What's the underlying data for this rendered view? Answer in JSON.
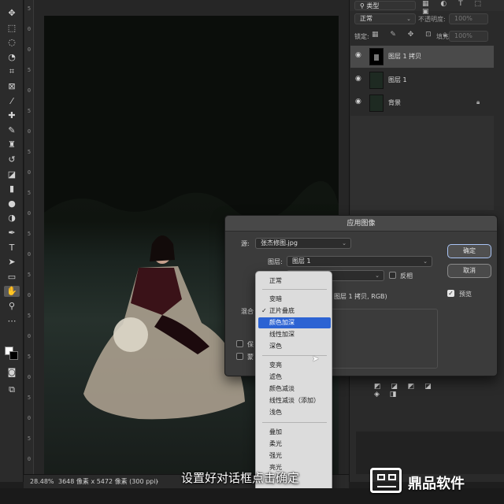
{
  "toolbar": {
    "tools": [
      {
        "name": "move-tool",
        "glyph": "✥"
      },
      {
        "name": "marquee-tool",
        "glyph": "⬚"
      },
      {
        "name": "lasso-tool",
        "glyph": "◌"
      },
      {
        "name": "quick-select-tool",
        "glyph": "◔"
      },
      {
        "name": "crop-tool",
        "glyph": "⌗"
      },
      {
        "name": "frame-tool",
        "glyph": "⊠"
      },
      {
        "name": "eyedropper-tool",
        "glyph": "⁄"
      },
      {
        "name": "healing-brush-tool",
        "glyph": "✚"
      },
      {
        "name": "brush-tool",
        "glyph": "✎"
      },
      {
        "name": "clone-stamp-tool",
        "glyph": "♜"
      },
      {
        "name": "history-brush-tool",
        "glyph": "↺"
      },
      {
        "name": "eraser-tool",
        "glyph": "◪"
      },
      {
        "name": "gradient-tool",
        "glyph": "▮"
      },
      {
        "name": "blur-tool",
        "glyph": "●"
      },
      {
        "name": "dodge-tool",
        "glyph": "◑"
      },
      {
        "name": "pen-tool",
        "glyph": "✒"
      },
      {
        "name": "type-tool",
        "glyph": "T"
      },
      {
        "name": "path-selection-tool",
        "glyph": "➤"
      },
      {
        "name": "rectangle-tool",
        "glyph": "▭"
      },
      {
        "name": "hand-tool",
        "glyph": "✋"
      },
      {
        "name": "zoom-tool",
        "glyph": "⚲"
      },
      {
        "name": "more-tools",
        "glyph": "⋯"
      }
    ]
  },
  "ruler": {
    "marks": [
      "5",
      "0",
      "0",
      "5",
      "0",
      "5",
      "0",
      "5",
      "0",
      "5",
      "0",
      "5",
      "0",
      "5",
      "0",
      "5",
      "0",
      "5",
      "0",
      "5",
      "0",
      "5",
      "0"
    ]
  },
  "status": {
    "zoom": "28.48%",
    "doc": "3648 像素 x 5472 像素 (300 ppi)"
  },
  "layers_panel": {
    "search_placeholder": "类型",
    "blend_mode": "正常",
    "opacity_label": "不透明度:",
    "opacity_value": "100%",
    "lock_label": "锁定:",
    "fill_label": "填充:",
    "fill_value": "100%",
    "layers": [
      {
        "name": "图层 1 拷贝",
        "selected": true
      },
      {
        "name": "图层 1",
        "selected": false
      },
      {
        "name": "背景",
        "selected": false,
        "locked": true
      }
    ]
  },
  "dialog": {
    "title": "应用图像",
    "source_label": "源:",
    "source_value": "张杰修图.jpg",
    "layer_label": "图层:",
    "layer_value": "图层 1",
    "invert_label": "反相",
    "target_text": "图层 1 拷贝, RGB)",
    "blend_label": "混合",
    "ok_label": "确定",
    "cancel_label": "取消",
    "preview_label": "预览",
    "preserve_label": "保",
    "mask_label": "蒙"
  },
  "blend_menu": {
    "groups": [
      [
        {
          "label": "正常"
        }
      ],
      [
        {
          "label": "变暗"
        },
        {
          "label": "正片叠底",
          "checked": true
        },
        {
          "label": "颜色加深",
          "highlighted": true
        },
        {
          "label": "线性加深"
        },
        {
          "label": "深色"
        }
      ],
      [
        {
          "label": "变亮"
        },
        {
          "label": "滤色"
        },
        {
          "label": "颜色减淡"
        },
        {
          "label": "线性减淡（添加）"
        },
        {
          "label": "浅色"
        }
      ],
      [
        {
          "label": "叠加"
        },
        {
          "label": "柔光"
        },
        {
          "label": "强光"
        },
        {
          "label": "亮光"
        }
      ]
    ],
    "more_arrow": "⌄"
  },
  "caption": "设置好对话框点击确定",
  "watermark": "鼎品软件",
  "colors": {
    "accent": "#2c63d3",
    "panel": "#2a2a2a",
    "dialog": "#3b3b3b",
    "menu": "#dcdcdc"
  }
}
